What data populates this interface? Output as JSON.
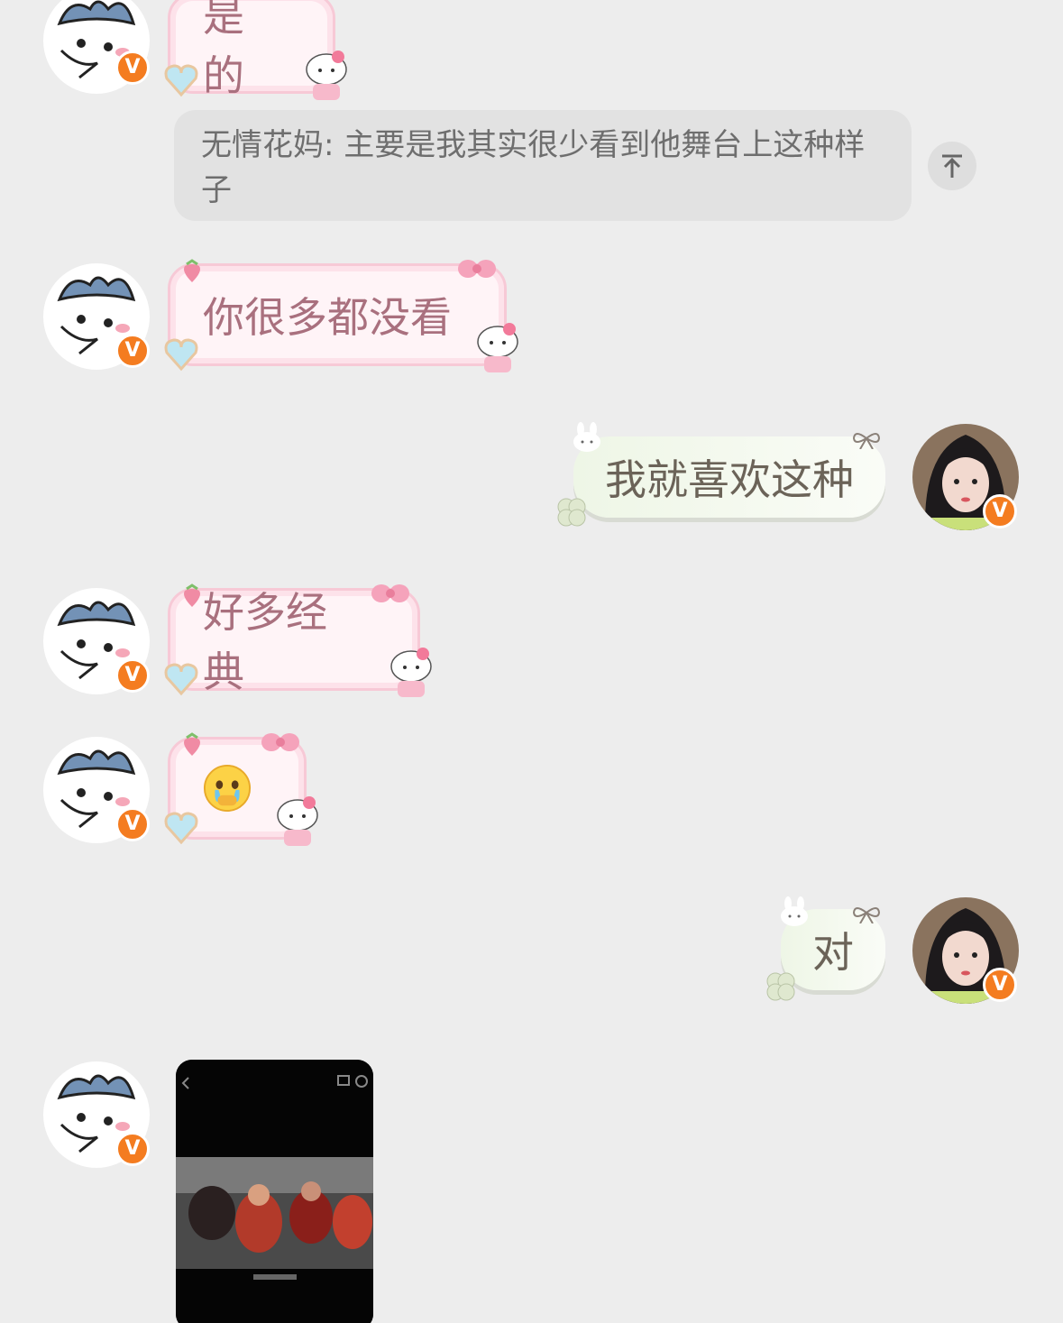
{
  "messages": {
    "m1": {
      "text": "是的"
    },
    "quote": {
      "text": "无情花妈: 主要是我其实很少看到他舞台上这种样子"
    },
    "m2": {
      "text": "你很多都没看"
    },
    "m3": {
      "text": "我就喜欢这种"
    },
    "m4": {
      "text": "好多经典"
    },
    "m5": {
      "emoji": "😰"
    },
    "m6": {
      "text": "对"
    }
  },
  "badges": {
    "verified_label": "V"
  },
  "colors": {
    "badge_orange": "#f47c20",
    "pink_text": "#a9707e",
    "background": "#ededed"
  }
}
